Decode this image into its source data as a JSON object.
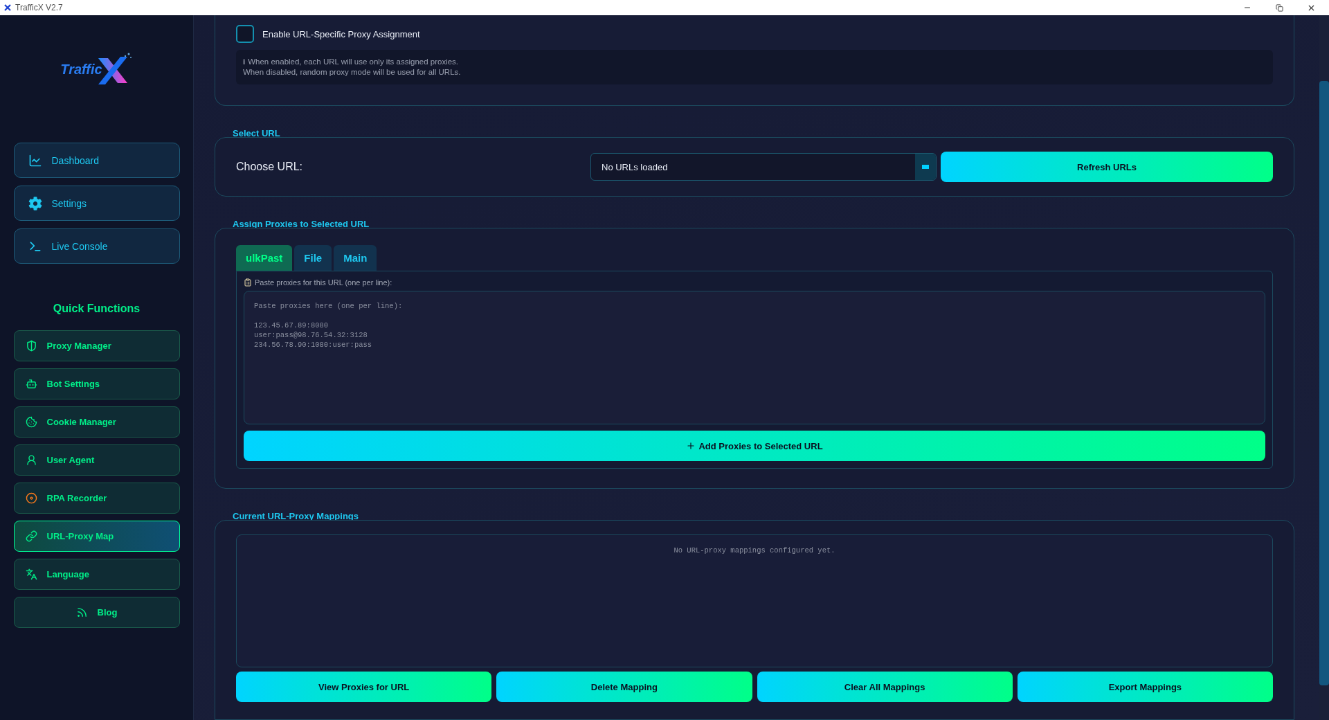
{
  "window": {
    "title": "TrafficX V2.7"
  },
  "sidebar": {
    "logo_text": "Traffic",
    "nav": [
      {
        "label": "Dashboard",
        "selected": false
      },
      {
        "label": "Settings",
        "selected": false
      },
      {
        "label": "Live Console",
        "selected": false
      }
    ],
    "quick_title": "Quick Functions",
    "quick": [
      {
        "label": "Proxy Manager",
        "selected": false
      },
      {
        "label": "Bot Settings",
        "selected": false
      },
      {
        "label": "Cookie Manager",
        "selected": false
      },
      {
        "label": "User Agent",
        "selected": false
      },
      {
        "label": "RPA Recorder",
        "selected": false
      },
      {
        "label": "URL-Proxy Map",
        "selected": true
      },
      {
        "label": "Language",
        "selected": false
      },
      {
        "label": "Blog",
        "selected": false
      }
    ]
  },
  "enable": {
    "label": "Enable URL-Specific Proxy Assignment",
    "checked": false,
    "info_icon": "i",
    "info": [
      "When enabled, each URL will use only its assigned proxies.",
      "When disabled, random proxy mode will be used for all URLs."
    ]
  },
  "select_url": {
    "title": "Select URL",
    "label": "Choose URL:",
    "value": "No URLs loaded",
    "button": "Refresh URLs"
  },
  "assign": {
    "title": "Assign Proxies to Selected URL",
    "tabs": [
      {
        "label": "ulkPast",
        "selected": true
      },
      {
        "label": "File",
        "selected": false
      },
      {
        "label": "Main",
        "selected": false
      }
    ],
    "hint": "Paste proxies for this URL (one per line):",
    "placeholder": "Paste proxies here (one per line):\n\n123.45.67.89:8080\nuser:pass@98.76.54.32:3128\n234.56.78.90:1080:user:pass",
    "button": "Add Proxies to Selected URL"
  },
  "mappings": {
    "title": "Current URL-Proxy Mappings",
    "empty": "No URL-proxy mappings configured yet.",
    "buttons": [
      "View Proxies for URL",
      "Delete Mapping",
      "Clear All Mappings",
      "Export Mappings"
    ]
  }
}
